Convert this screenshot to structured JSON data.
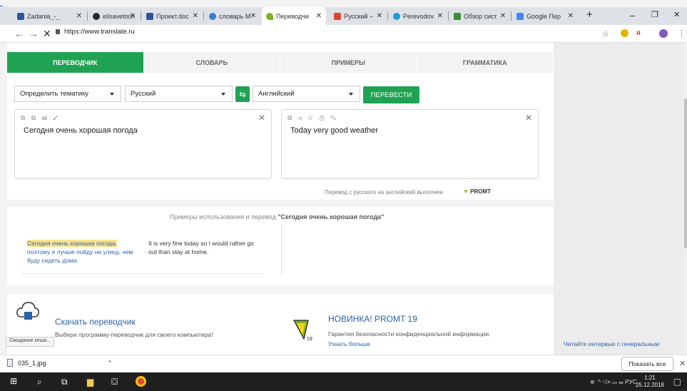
{
  "browser": {
    "tabs": [
      {
        "title": "Zadania_-_",
        "color": "#2b579a"
      },
      {
        "title": "elisavetoch",
        "color": "#24292e"
      },
      {
        "title": "Проект.doc",
        "color": "#2b579a"
      },
      {
        "title": "словарь М",
        "color": "#3b7bd4"
      },
      {
        "title": "Переводчи",
        "color": "#7bb51d",
        "active": true
      },
      {
        "title": "Русский –",
        "color": "#d9472b"
      },
      {
        "title": "Perevodov",
        "color": "#1a9bd7"
      },
      {
        "title": "Обзор сист",
        "color": "#3a8f3a"
      },
      {
        "title": "Google Пер",
        "color": "#4285f4"
      }
    ],
    "url": "https://www.translate.ru",
    "new_tab": "+",
    "min": "–",
    "max": "❐",
    "close": "✕"
  },
  "nav": {
    "tabs": [
      "ПЕРЕВОДЧИК",
      "СЛОВАРЬ",
      "ПРИМЕРЫ",
      "ГРАММАТИКА"
    ],
    "active_index": 0
  },
  "translator": {
    "topic": "Определить тематику",
    "source_lang": "Русский",
    "target_lang": "Английский",
    "translate_button": "ПЕРЕВЕСТИ",
    "source_text": "Сегодня очень хорошая погода",
    "target_text": "Today very good weather",
    "note": "Перевод с русского на английский выполнен",
    "engine": "PROMT"
  },
  "examples": {
    "header_prefix": "Примеры использования и перевод",
    "header_query": "\"Сегодня очень хорошая погода\"",
    "source_highlight": "Сегодня очень хорошая погода,",
    "source_rest": "поэтому я лучше пойду на улицу, чем буду сидеть дома.",
    "target": "It is very fine today so I would rather go out than stay at home."
  },
  "promo": {
    "download_title": "Скачать переводчик",
    "download_desc": "Выбери программу-переводчик для своего компьютера!",
    "promt_title": "НОВИНКА! PROMT 19",
    "promt_desc": "Гарантия безопасности конфиденциальной информации.",
    "promt_more": "Узнать больше",
    "side_text": "Читайте интервью с генеральным",
    "status": "Ожидание кеша..."
  },
  "downloads": {
    "file": "035_1.jpg",
    "show_all": "Показать все"
  },
  "taskbar": {
    "lang": "РУС",
    "time": "1:21",
    "date": "25.12.2018"
  }
}
